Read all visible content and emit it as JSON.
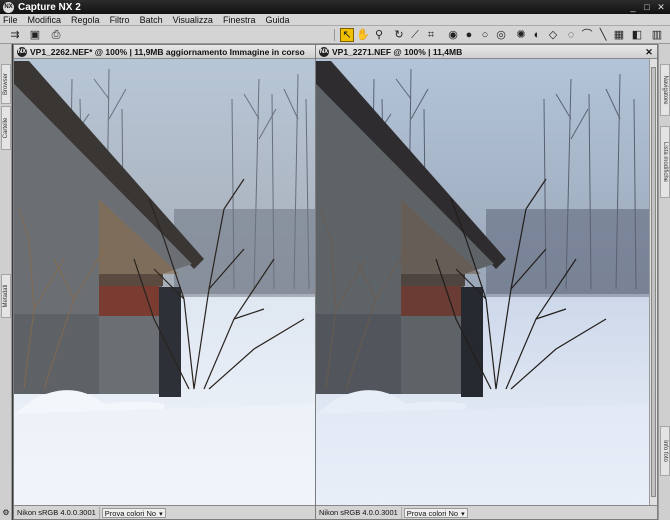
{
  "app": {
    "title": "Capture NX 2"
  },
  "menu": [
    "File",
    "Modifica",
    "Regola",
    "Filtro",
    "Batch",
    "Visualizza",
    "Finestra",
    "Guida"
  ],
  "left_panel": {
    "tabs": [
      "Browser",
      "Cartelle",
      "Metadati"
    ]
  },
  "right_panel": {
    "tabs": [
      "Navigatore",
      "Lista modifiche",
      "Info foto"
    ]
  },
  "documents": [
    {
      "title": "VP1_2262.NEF* @ 100% | 11,9MB aggiornamento Immagine in corso",
      "status_profile": "Nikon sRGB 4.0.0.3001",
      "status_softproof": "Prova colori No"
    },
    {
      "title": "VP1_2271.NEF @ 100% | 11,4MB",
      "status_profile": "Nikon sRGB 4.0.0.3001",
      "status_softproof": "Prova colori No"
    }
  ],
  "colors": {
    "titlebar": "#1a1a1a",
    "active_tool": "#f0c000",
    "sky": "#a8b8cc",
    "snow": "#e6eef8",
    "wall": "#6e7278",
    "roof": "#3a3634"
  },
  "icons": {
    "tools": [
      "direct-select-icon",
      "hand-icon",
      "zoom-icon",
      "rotate-icon",
      "straighten-icon",
      "crop-icon",
      "red-eye-icon",
      "color-control-point-icon",
      "black-control-point-icon",
      "white-control-point-icon",
      "neutral-control-point-icon",
      "red-eye-tool-icon",
      "eye-icon",
      "lasso-icon",
      "selection-brush-icon",
      "fill-icon",
      "gradient-icon",
      "graduated-icon",
      "panel-toggle-icon"
    ]
  }
}
